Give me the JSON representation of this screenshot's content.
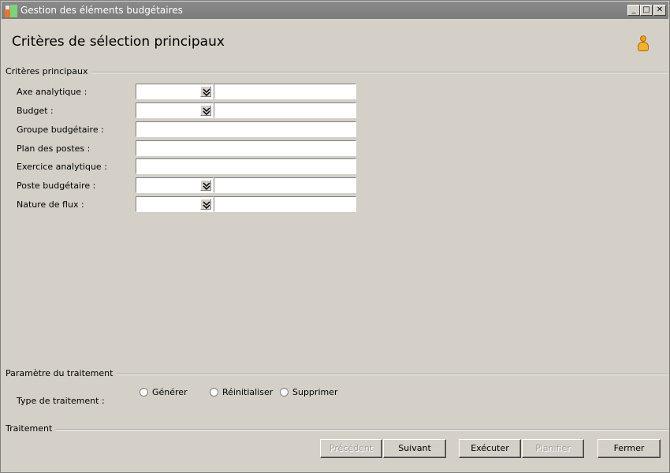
{
  "window": {
    "title": "Gestion des éléments budgétaires",
    "controls": {
      "minimize": "_",
      "maximize": "□",
      "close": "✕"
    }
  },
  "header": {
    "title": "Critères de sélection principaux",
    "user_icon": "user-icon"
  },
  "sections": {
    "main": "Critères principaux",
    "params": "Paramètre du traitement",
    "treatment": "Traitement"
  },
  "fields": {
    "axe": {
      "label": "Axe analytique :",
      "code": "",
      "value": ""
    },
    "budget": {
      "label": "Budget :",
      "code": "",
      "value": ""
    },
    "groupe": {
      "label": "Groupe budgétaire :",
      "value": ""
    },
    "plan": {
      "label": "Plan des postes :",
      "value": ""
    },
    "exercice": {
      "label": "Exercice analytique :",
      "value": ""
    },
    "poste": {
      "label": "Poste budgétaire :",
      "code": "",
      "value": ""
    },
    "nature": {
      "label": "Nature de flux :",
      "code": "",
      "value": ""
    }
  },
  "params": {
    "type_label": "Type de traitement :",
    "options": [
      "Générer",
      "Réinitialiser",
      "Supprimer"
    ]
  },
  "buttons": {
    "previous": "Précédent",
    "next": "Suivant",
    "execute": "Exécuter",
    "schedule": "Planifier",
    "close": "Fermer"
  }
}
